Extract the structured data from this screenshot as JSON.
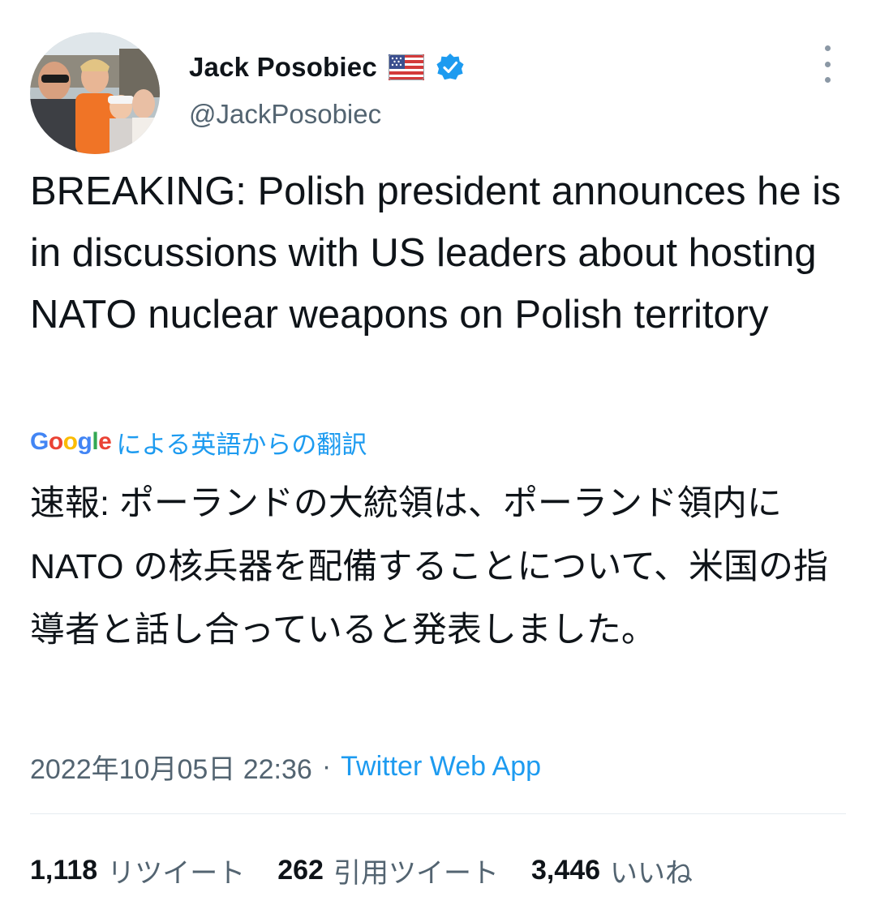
{
  "author": {
    "display_name": "Jack Posobiec",
    "handle": "@JackPosobiec",
    "flag_icon": "us-flag-icon",
    "verified_icon": "verified-badge-icon"
  },
  "tweet": {
    "text": "BREAKING: Polish president announces he is in discussions with US leaders about hosting NATO nuclear weapons on Polish territory"
  },
  "translation": {
    "google_logo": "Google",
    "label": "による英語からの翻訳",
    "text": "速報: ポーランドの大統領は、ポーランド領内に NATO の核兵器を配備することについて、米国の指導者と話し合っていると発表しました。"
  },
  "meta": {
    "timestamp": "2022年10月05日 22:36",
    "separator": "·",
    "source": "Twitter Web App"
  },
  "stats": {
    "retweets": {
      "count": "1,118",
      "label": "リツイート"
    },
    "quotes": {
      "count": "262",
      "label": "引用ツイート"
    },
    "likes": {
      "count": "3,446",
      "label": "いいね"
    }
  },
  "colors": {
    "accent": "#1d9bf0",
    "text_primary": "#0f1419",
    "text_secondary": "#536471",
    "divider": "#e6ecf0"
  }
}
